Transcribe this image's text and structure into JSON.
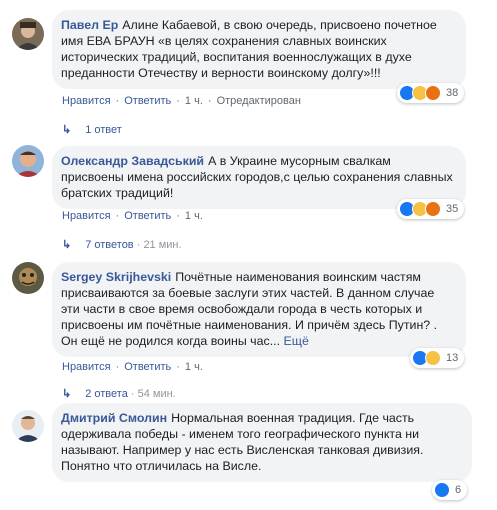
{
  "comments": [
    {
      "author": "Павел Ер",
      "text": "Алине Кабаевой, в свою очередь, присвоено почетное имя ЕВА БРАУН «в целях сохранения славных воинских исторических традиций, воспитания военнослужащих в духе преданности Отечеству и верности воинскому долгу»!!!",
      "like_label": "Нравится",
      "reply_label": "Ответить",
      "time": "1 ч.",
      "edited": "Отредактирован",
      "reactions": [
        "like",
        "haha",
        "angry"
      ],
      "reaction_count": "38",
      "replies_label": "1 ответ",
      "replies_meta": ""
    },
    {
      "author": "Олександр Завадський",
      "text": "А в Украине мусорным свалкам присвоены имена российских городов,с целью сохранения славных братских традиций!",
      "like_label": "Нравится",
      "reply_label": "Ответить",
      "time": "1 ч.",
      "reactions": [
        "like",
        "haha",
        "angry"
      ],
      "reaction_count": "35",
      "replies_label": "7 ответов",
      "replies_meta": "21 мин."
    },
    {
      "author": "Sergey Skrijhevski",
      "text": "Почётные наименования воинским частям присваиваются за боевые заслуги этих частей. В данном случае эти части в свое время освобождали города в честь которых и присвоены им почётные наименования. И причём здесь Путин? . Он ещё не родился когда воины час...",
      "more_label": "Ещё",
      "like_label": "Нравится",
      "reply_label": "Ответить",
      "time": "1 ч.",
      "reactions": [
        "like",
        "haha"
      ],
      "reaction_count": "13",
      "replies_label": "2 ответа",
      "replies_meta": "54 мин."
    },
    {
      "author": "Дмитрий Смолин",
      "text": "Нормальная военная традиция. Где часть одерживала победы - именем того географического пункта ни называют. Например у нас есть Висленская танковая дивизия. Понятно что отличилась на Висле.",
      "like_label": "Нравится",
      "reply_label": "Ответить",
      "time": "1 ч.",
      "reactions": [
        "like"
      ],
      "reaction_count": "6"
    }
  ],
  "colors": {
    "link": "#385898",
    "bubble": "#f2f3f5",
    "like": "#1877f2",
    "haha": "#f7c244",
    "angry": "#e9710f"
  }
}
